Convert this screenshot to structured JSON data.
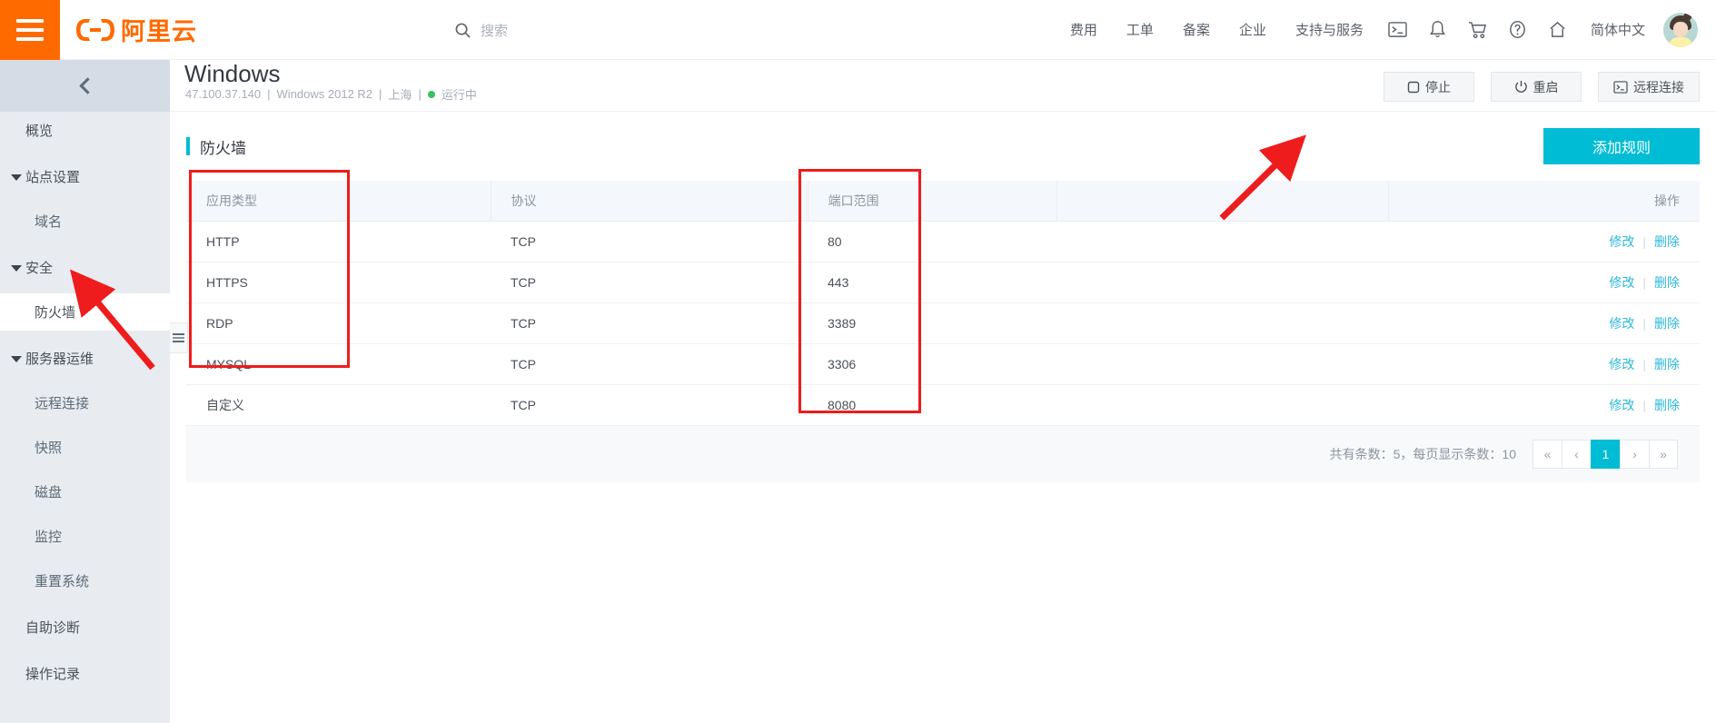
{
  "topbar": {
    "menu_icon": "hamburger-icon",
    "logo_text": "阿里云",
    "search_placeholder": "搜索",
    "nav_links": [
      "费用",
      "工单",
      "备案",
      "企业",
      "支持与服务"
    ],
    "icons": [
      "terminal-icon",
      "bell-icon",
      "cart-icon",
      "help-icon",
      "home-icon"
    ],
    "language": "简体中文",
    "accent_orange": "#ff6a00"
  },
  "sidebar": {
    "items": [
      {
        "label": "概览",
        "level": 0,
        "caret": false,
        "active": false
      },
      {
        "label": "站点设置",
        "level": 0,
        "caret": true,
        "active": false
      },
      {
        "label": "域名",
        "level": 1,
        "caret": false,
        "active": false
      },
      {
        "label": "安全",
        "level": 0,
        "caret": true,
        "active": false
      },
      {
        "label": "防火墙",
        "level": 1,
        "caret": false,
        "active": true
      },
      {
        "label": "服务器运维",
        "level": 0,
        "caret": true,
        "active": false
      },
      {
        "label": "远程连接",
        "level": 1,
        "caret": false,
        "active": false
      },
      {
        "label": "快照",
        "level": 1,
        "caret": false,
        "active": false
      },
      {
        "label": "磁盘",
        "level": 1,
        "caret": false,
        "active": false
      },
      {
        "label": "监控",
        "level": 1,
        "caret": false,
        "active": false
      },
      {
        "label": "重置系统",
        "level": 1,
        "caret": false,
        "active": false
      },
      {
        "label": "自助诊断",
        "level": 0,
        "caret": false,
        "active": false
      },
      {
        "label": "操作记录",
        "level": 0,
        "caret": false,
        "active": false
      }
    ]
  },
  "page_header": {
    "title": "Windows",
    "ip": "47.100.37.140",
    "os": "Windows 2012 R2",
    "region": "上海",
    "status": "运行中",
    "status_color": "#39c15b",
    "separator": "|",
    "actions": [
      {
        "label": "停止",
        "icon": "stop-icon"
      },
      {
        "label": "重启",
        "icon": "power-icon"
      },
      {
        "label": "远程连接",
        "icon": "terminal-icon"
      }
    ]
  },
  "main": {
    "section_title": "防火墙",
    "accent_cyan": "#00bcd4",
    "add_button": "添加规则",
    "table": {
      "columns": [
        "应用类型",
        "协议",
        "端口范围",
        "",
        "操作"
      ],
      "rows": [
        {
          "app": "HTTP",
          "proto": "TCP",
          "port": "80",
          "blank": "",
          "edit": "修改",
          "delete": "删除"
        },
        {
          "app": "HTTPS",
          "proto": "TCP",
          "port": "443",
          "blank": "",
          "edit": "修改",
          "delete": "删除"
        },
        {
          "app": "RDP",
          "proto": "TCP",
          "port": "3389",
          "blank": "",
          "edit": "修改",
          "delete": "删除"
        },
        {
          "app": "MYSQL",
          "proto": "TCP",
          "port": "3306",
          "blank": "",
          "edit": "修改",
          "delete": "删除"
        },
        {
          "app": "自定义",
          "proto": "TCP",
          "port": "8080",
          "blank": "",
          "edit": "修改",
          "delete": "删除"
        }
      ]
    },
    "footer": {
      "count_text": "共有条数：5，每页显示条数：10",
      "pager": [
        "«",
        "‹",
        "1",
        "›",
        "»"
      ],
      "active_page": "1"
    }
  },
  "annotations": {
    "color": "#ee1c1c",
    "boxes": [
      "app-type-column-highlight",
      "port-range-column-highlight"
    ],
    "arrows": [
      "arrow-to-firewall-menu",
      "arrow-to-add-rule-button"
    ]
  }
}
